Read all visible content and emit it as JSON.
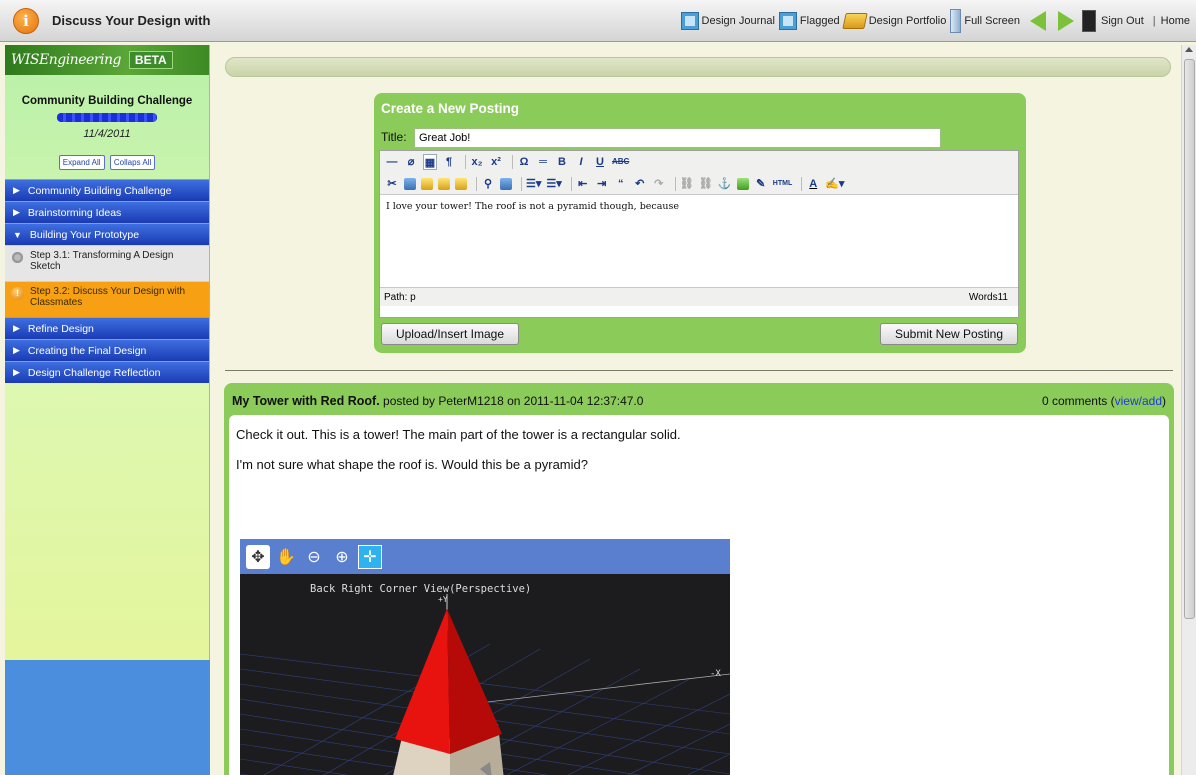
{
  "header": {
    "step_title": "Discuss Your Design with",
    "nav": {
      "design_journal": "Design Journal",
      "flagged": "Flagged",
      "design_portfolio": "Design Portfolio",
      "full_screen": "Full Screen",
      "sign_out": "Sign Out",
      "separator": "|",
      "home": "Home"
    }
  },
  "sidebar": {
    "logo": "WISEngineering",
    "beta": "BETA",
    "project_title": "Community Building Challenge",
    "project_date": "11/4/2011",
    "expand_all": "Expand All",
    "collapse_all": "Collaps All",
    "items": [
      {
        "type": "category",
        "label": "Community Building Challenge",
        "expanded": false
      },
      {
        "type": "category",
        "label": "Brainstorming Ideas",
        "expanded": false
      },
      {
        "type": "category",
        "label": "Building Your Prototype",
        "expanded": true
      },
      {
        "type": "step",
        "label": "Step 3.1: Transforming A Design Sketch",
        "icon": "gear-icon"
      },
      {
        "type": "step",
        "label": "Step 3.2: Discuss Your Design with Classmates",
        "icon": "alert-icon",
        "active": true
      },
      {
        "type": "category",
        "label": "Refine Design",
        "expanded": false
      },
      {
        "type": "category",
        "label": "Creating the Final Design",
        "expanded": false
      },
      {
        "type": "category",
        "label": "Design Challenge Reflection",
        "expanded": false
      }
    ]
  },
  "new_posting": {
    "heading": "Create a New Posting",
    "title_label": "Title:",
    "title_value": "Great Job!",
    "body_text": "I love your tower!  The roof is not a pyramid though, because",
    "path_label": "Path: p",
    "word_count": "Words11",
    "upload_button": "Upload/Insert Image",
    "submit_button": "Submit New Posting",
    "toolbar": {
      "bold": "B",
      "italic": "I",
      "underline": "U",
      "strike": "ABC",
      "omega": "Ω",
      "paragraph": "¶",
      "sub": "x₂",
      "sup": "x²",
      "html": "HTML",
      "font_color": "A"
    }
  },
  "post": {
    "title": "My Tower with Red Roof.",
    "meta_prefix": " posted by PeterM1218 on 2011-11-04 12:37:47.0",
    "comments": "0 comments (",
    "comments_link": "view/add",
    "comments_close": ")",
    "paragraphs": [
      "Check it out.  This is a tower!  The main part of the tower is a rectangular solid.",
      "I'm not sure what shape the roof is.  Would this be a pyramid?"
    ],
    "viewer": {
      "caption": "Back Right Corner View(Perspective)",
      "y_axis": "+Y",
      "x_axis": "-X"
    }
  },
  "colors": {
    "panel_green": "#8bcb59",
    "nav_blue": "#1a3bb4",
    "active_orange": "#f7a014",
    "roof_red": "#e8120f"
  }
}
